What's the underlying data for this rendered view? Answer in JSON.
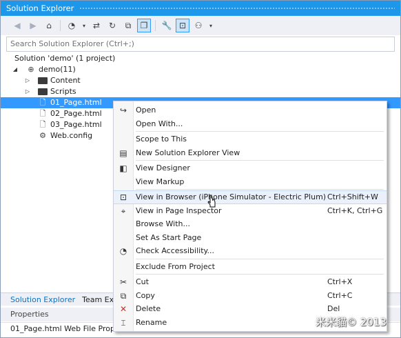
{
  "window": {
    "title": "Solution Explorer"
  },
  "toolbar": {
    "buttons": [
      {
        "name": "back-button",
        "glyph": "◀",
        "disabled": true
      },
      {
        "name": "forward-button",
        "glyph": "▶",
        "disabled": true
      },
      {
        "name": "home-button",
        "glyph": "⌂",
        "disabled": false
      },
      {
        "name": "pending-changes-button",
        "glyph": "◔",
        "disabled": false
      },
      {
        "name": "pending-dropdown-button",
        "glyph": "▾",
        "disabled": false
      },
      {
        "name": "sync-button",
        "glyph": "⇄",
        "disabled": false
      },
      {
        "name": "refresh-button",
        "glyph": "↻",
        "disabled": false
      },
      {
        "name": "collapse-all-button",
        "glyph": "⧉",
        "disabled": false
      },
      {
        "name": "show-all-files-button",
        "glyph": "❐",
        "disabled": false,
        "active": true
      },
      {
        "name": "properties-button",
        "glyph": "🔧",
        "disabled": false
      },
      {
        "name": "preview-button",
        "glyph": "⊡",
        "disabled": false,
        "active": true
      },
      {
        "name": "class-view-button",
        "glyph": "⚇",
        "disabled": false
      },
      {
        "name": "more-dropdown-button",
        "glyph": "▾",
        "disabled": false
      }
    ]
  },
  "search": {
    "placeholder": "Search Solution Explorer (Ctrl+;)"
  },
  "tree": {
    "nodes": [
      {
        "label": "Solution 'demo' (1 project)",
        "icon": "solution-icon",
        "level": 0,
        "arrow": ""
      },
      {
        "label": "demo(11)",
        "icon": "globe-icon",
        "level": 0,
        "arrow": "◢"
      },
      {
        "label": "Content",
        "icon": "folder-icon",
        "level": 1,
        "arrow": "▷"
      },
      {
        "label": "Scripts",
        "icon": "folder-icon",
        "level": 1,
        "arrow": "▷"
      },
      {
        "label": "01_Page.html",
        "icon": "html-file-icon",
        "level": 1,
        "arrow": "",
        "selected": true
      },
      {
        "label": "02_Page.html",
        "icon": "html-file-icon",
        "level": 1,
        "arrow": ""
      },
      {
        "label": "03_Page.html",
        "icon": "html-file-icon",
        "level": 1,
        "arrow": ""
      },
      {
        "label": "Web.config",
        "icon": "config-file-icon",
        "level": 1,
        "arrow": ""
      }
    ]
  },
  "bottom_tabs": [
    {
      "label": "Solution Explorer",
      "active": true
    },
    {
      "label": "Team Explo",
      "active": false
    }
  ],
  "properties": {
    "header": "Properties",
    "selection": "01_Page.html  Web File Prope"
  },
  "context_menu": {
    "items": [
      {
        "label": "Open",
        "shortcut": "",
        "icon": "open-arrow-icon",
        "glyph": "↪"
      },
      {
        "label": "Open With...",
        "shortcut": "",
        "icon": "",
        "glyph": ""
      },
      {
        "separator": true
      },
      {
        "label": "Scope to This",
        "shortcut": "",
        "icon": "",
        "glyph": ""
      },
      {
        "label": "New Solution Explorer View",
        "shortcut": "",
        "icon": "new-view-icon",
        "glyph": "▤"
      },
      {
        "separator": true
      },
      {
        "label": "View Designer",
        "shortcut": "",
        "icon": "designer-icon",
        "glyph": "◧"
      },
      {
        "label": "View Markup",
        "shortcut": "",
        "icon": "",
        "glyph": ""
      },
      {
        "separator": true
      },
      {
        "label": "View in Browser (iPhone Simulator - Electric Plum)",
        "shortcut": "Ctrl+Shift+W",
        "icon": "browser-icon",
        "glyph": "⊡",
        "hover": true
      },
      {
        "label": "View in Page Inspector",
        "shortcut": "Ctrl+K, Ctrl+G",
        "icon": "page-inspector-icon",
        "glyph": "⌖"
      },
      {
        "label": "Browse With...",
        "shortcut": "",
        "icon": "",
        "glyph": ""
      },
      {
        "label": "Set As Start Page",
        "shortcut": "",
        "icon": "",
        "glyph": ""
      },
      {
        "label": "Check Accessibility...",
        "shortcut": "",
        "icon": "accessibility-icon",
        "glyph": "◔"
      },
      {
        "separator": true
      },
      {
        "label": "Exclude From Project",
        "shortcut": "",
        "icon": "",
        "glyph": ""
      },
      {
        "separator": true
      },
      {
        "label": "Cut",
        "shortcut": "Ctrl+X",
        "icon": "scissors-icon",
        "glyph": "✂"
      },
      {
        "label": "Copy",
        "shortcut": "Ctrl+C",
        "icon": "copy-icon",
        "glyph": "⧉"
      },
      {
        "label": "Delete",
        "shortcut": "Del",
        "icon": "delete-x-icon",
        "glyph": "✕",
        "color": "#c4322c"
      },
      {
        "label": "Rename",
        "shortcut": "",
        "icon": "rename-icon",
        "glyph": "⌶"
      }
    ]
  },
  "watermark": "米米貓© 2013",
  "colors": {
    "accent": "#1c97ea",
    "selection": "#3399ff",
    "hover": "#eaf1fb"
  }
}
